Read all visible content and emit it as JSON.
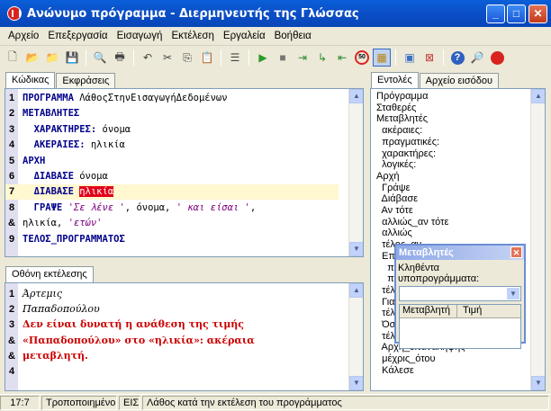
{
  "window": {
    "title": "Ανώνυμο πρόγραμμα - Διερμηνευτής της Γλώσσας",
    "btn_min": "_",
    "btn_max": "□",
    "btn_close": "✕"
  },
  "menu": [
    "Αρχείο",
    "Επεξεργασία",
    "Εισαγωγή",
    "Εκτέλεση",
    "Εργαλεία",
    "Βοήθεια"
  ],
  "code_tabs": [
    "Κώδικας",
    "Εκφράσεις"
  ],
  "code_lines": [
    {
      "n": "1",
      "parts": [
        {
          "t": "ΠΡΟΓΡΑΜΜΑ ",
          "c": "kw"
        },
        {
          "t": "ΛάθοςΣτηνΕισαγωγήΔεδομένων",
          "c": ""
        }
      ]
    },
    {
      "n": "2",
      "parts": [
        {
          "t": "ΜΕΤΑΒΛΗΤΕΣ",
          "c": "kw"
        }
      ]
    },
    {
      "n": "3",
      "parts": [
        {
          "t": "  ΧΑΡΑΚΤΗΡΕΣ: ",
          "c": "kw"
        },
        {
          "t": "όνομα",
          "c": ""
        }
      ]
    },
    {
      "n": "4",
      "parts": [
        {
          "t": "  ΑΚΕΡΑΙΕΣ: ",
          "c": "kw"
        },
        {
          "t": "ηλικία",
          "c": ""
        }
      ]
    },
    {
      "n": "5",
      "parts": [
        {
          "t": "ΑΡΧΗ",
          "c": "kw"
        }
      ]
    },
    {
      "n": "6",
      "parts": [
        {
          "t": "  ΔΙΑΒΑΣΕ ",
          "c": "kw"
        },
        {
          "t": "όνομα",
          "c": ""
        }
      ]
    },
    {
      "n": "7",
      "parts": [
        {
          "t": "  ΔΙΑΒΑΣΕ ",
          "c": "kw"
        },
        {
          "t": "ηλικία",
          "c": "err"
        }
      ]
    },
    {
      "n": "8",
      "parts": [
        {
          "t": "  ΓΡΑΨΕ ",
          "c": "kw"
        },
        {
          "t": "'Σε λένε '",
          "c": "str"
        },
        {
          "t": ", όνομα, ",
          "c": ""
        },
        {
          "t": "' και είσαι '",
          "c": "str"
        },
        {
          "t": ",",
          "c": ""
        }
      ]
    },
    {
      "n": "&",
      "parts": [
        {
          "t": "ηλικία, ",
          "c": ""
        },
        {
          "t": "'ετών'",
          "c": "str"
        }
      ]
    },
    {
      "n": "9",
      "parts": [
        {
          "t": "ΤΕΛΟΣ_ΠΡΟΓΡΑΜΜΑΤΟΣ",
          "c": "kw"
        }
      ]
    }
  ],
  "output_tab": "Οθόνη εκτέλεσης",
  "output_lines": [
    {
      "n": "1",
      "t": "Άρτεμις",
      "c": ""
    },
    {
      "n": "2",
      "t": "Παπαδοπούλου",
      "c": ""
    },
    {
      "n": "3",
      "t": "Δεν είναι δυνατή η ανάθεση της τιμής",
      "c": "red"
    },
    {
      "n": "&",
      "t": "«Παπαδοπούλου» στο «ηλικία»: ακέραια",
      "c": "red"
    },
    {
      "n": "&",
      "t": "μεταβλητή.",
      "c": "red"
    },
    {
      "n": "4",
      "t": "",
      "c": ""
    }
  ],
  "right_tabs": [
    "Εντολές",
    "Αρχείο εισόδου"
  ],
  "commands": [
    "Πρόγραμμα",
    "Σταθερές",
    "Μεταβλητές",
    "  ακέραιες:",
    "  πραγματικές:",
    "  χαρακτήρες:",
    "  λογικές:",
    "Αρχή",
    "  Γράψε",
    "  Διάβασε",
    "  Αν τότε",
    "  αλλιώς_αν τότε",
    "  αλλιώς",
    "  τέλος_αν",
    "  Επιλέξτε",
    "    περίπτωση",
    "    περίπτωση αλλιώς",
    "  τέλος_επιλογών",
    "  Για",
    "  τέλος_επανάληψης",
    "  Όσο επανάλαβε",
    "  τέλος_επανάληψης",
    "  Αρχή_επανάληψης",
    "  μέχρις_ότου",
    "  Κάλεσε"
  ],
  "popup": {
    "title": "Μεταβλητές",
    "close": "✕",
    "label": "Κληθέντα υποπρογράμματα:",
    "col_var": "Μεταβλητή",
    "col_val": "Τιμή"
  },
  "status": {
    "pos": "17:7",
    "state": "Τροποποιημένο",
    "mode": "ΕΙΣ",
    "message": "Λάθος κατά την εκτέλεση του προγράμματος"
  }
}
